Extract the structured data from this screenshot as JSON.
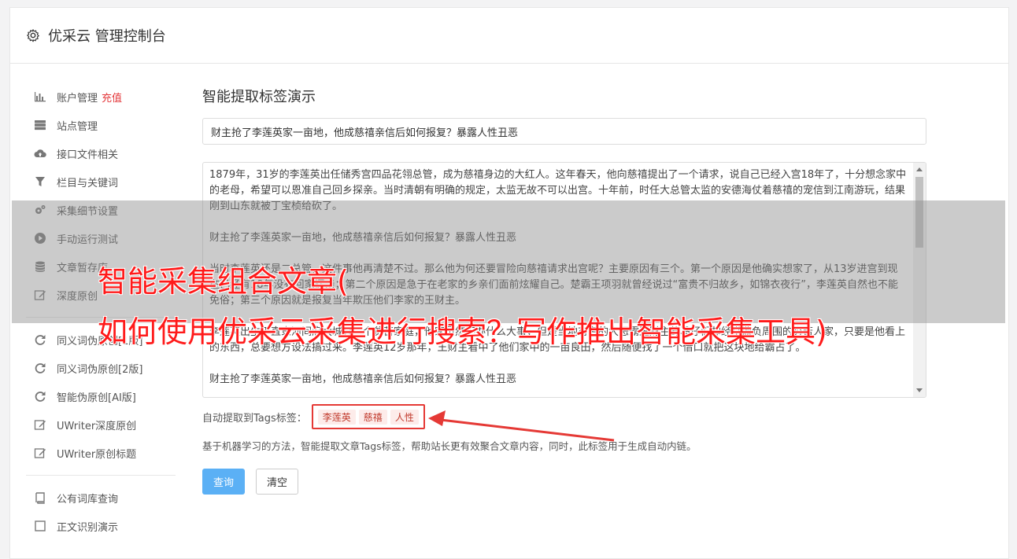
{
  "header": {
    "title": "优采云 管理控制台",
    "icon": "gear-icon"
  },
  "sidebar": {
    "group1": [
      {
        "label": "账户管理",
        "badge": "充值",
        "icon": "bar-chart-icon"
      },
      {
        "label": "站点管理",
        "icon": "server-icon"
      },
      {
        "label": "接口文件相关",
        "icon": "cloud-upload-icon"
      },
      {
        "label": "栏目与关键词",
        "icon": "filter-icon"
      },
      {
        "label": "采集细节设置",
        "icon": "cogs-icon"
      },
      {
        "label": "手动运行测试",
        "icon": "play-circle-icon"
      },
      {
        "label": "文章暂存库",
        "icon": "database-icon"
      },
      {
        "label": "深度原创",
        "icon": "edit-icon"
      }
    ],
    "group2": [
      {
        "label": "同义词伪原创[1版]",
        "icon": "refresh-icon"
      },
      {
        "label": "同义词伪原创[2版]",
        "icon": "refresh-icon"
      },
      {
        "label": "智能伪原创[AI版]",
        "icon": "refresh-icon"
      },
      {
        "label": "UWriter深度原创",
        "icon": "edit-icon"
      },
      {
        "label": "UWriter原创标题",
        "icon": "edit-icon"
      }
    ],
    "group3": [
      {
        "label": "公有词库查询",
        "icon": "book-icon"
      },
      {
        "label": "正文识别演示",
        "icon": "square-icon"
      }
    ]
  },
  "main": {
    "heading": "智能提取标签演示",
    "title_value": "财主抢了李莲英家一亩地，他成慈禧亲信后如何报复？暴露人性丑恶",
    "content_paragraphs": [
      "1879年，31岁的李莲英出任储秀宫四品花翎总管，成为慈禧身边的大红人。这年春天，他向慈禧提出了一个请求，说自己已经入宫18年了，十分想念家中的老母，希望可以恩准自己回乡探亲。当时清朝有明确的规定，太监无故不可以出宫。十年前，时任大总管太监的安德海仗着慈禧的宠信到江南游玩，结果刚到山东就被丁宝桢给砍了。",
      "财主抢了李莲英家一亩地，他成慈禧亲信后如何报复？暴露人性丑恶",
      "当时李莲英还是二总管，这件事他再清楚不过。那么他为何还要冒险向慈禧请求出宫呢？主要原因有三个。第一个原因是他确实想家了，从13岁进宫到现在已经有18年没有回家探亲；第二个原因是急于在老家的乡亲们面前炫耀自己。楚霸王项羽就曾经说过“富贵不归故乡，如锦衣夜行”，李莲英自然也不能免俗；第三个原因就是报复当年欺压他们李家的王财主。",
      "李莲英出生于直隶河间府大城县一个贫苦家庭，他家虽然不办什么大事，但是当地有名的大恶霸王财主的马仔们却经常欺负周围的穷苦人家，只要是他看上的东西，总要想方设法搞过来。李莲英12岁那年，王财主看中了他们家中的一亩良田，然后随便找了一个借口就把这块地给霸占了。",
      "财主抢了李莲英家一亩地，他成慈禧亲信后如何报复？暴露人性丑恶"
    ],
    "tags_label": "自动提取到Tags标签：",
    "tags": [
      "李莲英",
      "慈禧",
      "人性"
    ],
    "description": "基于机器学习的方法，智能提取文章Tags标签，帮助站长更有效聚合文章内容，同时，此标签用于生成自动内链。",
    "query_button": "查询",
    "clear_button": "清空"
  },
  "overlay": {
    "line1": "智能采集组合文章(",
    "line2": "如何使用优采云采集进行搜索？写作推出智能采集工具)"
  },
  "colors": {
    "accent": "#5bb0f5",
    "highlight": "#e53935",
    "overlay_text": "#ff1a1a"
  }
}
